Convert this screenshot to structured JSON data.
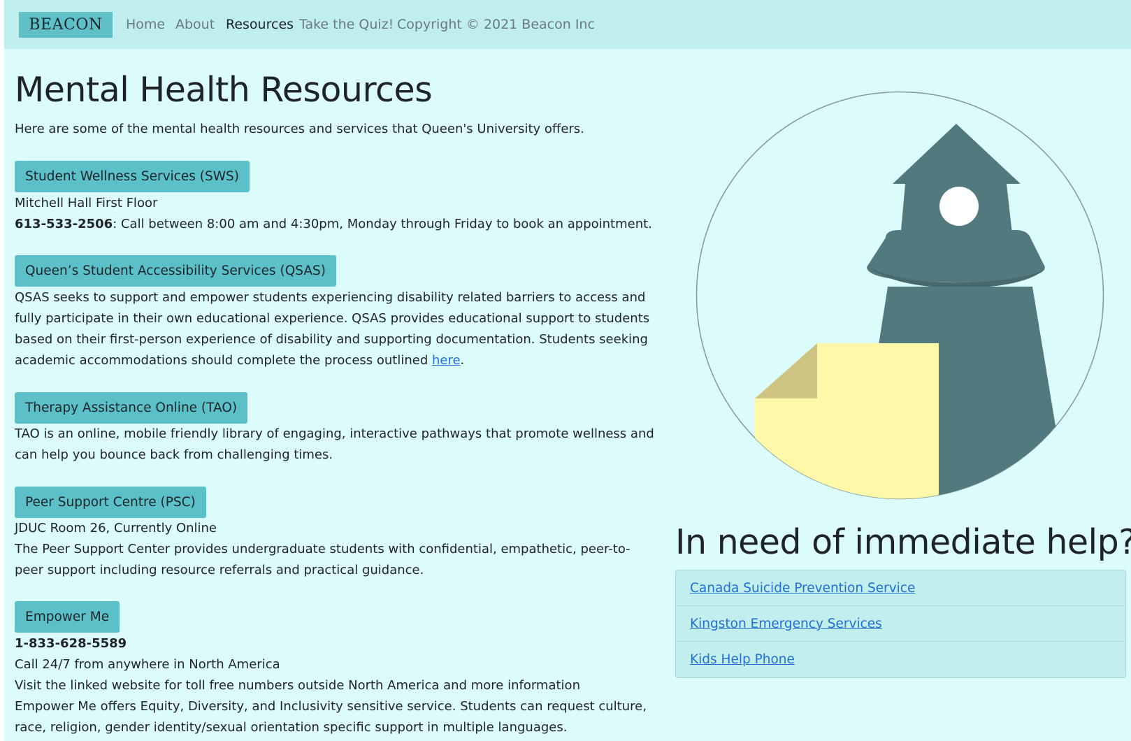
{
  "navbar": {
    "brand": "BEACON",
    "links": [
      "Home",
      "About",
      "Resources",
      "Take the Quiz!"
    ],
    "active": "Resources",
    "copyright": "Copyright © 2021 Beacon Inc"
  },
  "main": {
    "title": "Mental Health Resources",
    "intro": "Here are some of the mental health resources and services that Queen's University offers.",
    "sws": {
      "button": "Student Wellness Services (SWS)",
      "location": "Mitchell Hall First Floor",
      "phone": "613-533-2506",
      "hours": ": Call between 8:00 am and 4:30pm, Monday through Friday to book an appointment."
    },
    "qsas": {
      "button": "Queen’s Student Accessibility Services (QSAS)",
      "text": "QSAS seeks to support and empower students experiencing disability related barriers to access and fully participate in their own educational experience. QSAS provides educational support to students based on their first-person experience of disability and supporting documentation. Students seeking academic accommodations should complete the process outlined ",
      "link": "here",
      "after": "."
    },
    "tao": {
      "button": "Therapy Assistance Online (TAO)",
      "text": "TAO is an online, mobile friendly library of engaging, interactive pathways that promote wellness and can help you bounce back from challenging times."
    },
    "psc": {
      "button": "Peer Support Centre (PSC)",
      "location": "JDUC Room 26, Currently Online",
      "text": "The Peer Support Center provides undergraduate students with confidential, empathetic, peer-to-peer support including resource referrals and practical guidance."
    },
    "empower": {
      "button": "Empower Me",
      "phone": "1-833-628-5589",
      "line1": "Call 24/7 from anywhere in North America",
      "line2": "Visit the linked website for toll free numbers outside North America and more information",
      "text": "Empower Me offers Equity, Diversity, and Inclusivity sensitive service. Students can request culture, race, religion, gender identity/sexual orientation specific support in multiple languages."
    }
  },
  "sidebar": {
    "heading": "In need of immediate help?",
    "links": [
      "Canada Suicide Prevention Service",
      "Kingston Emergency Services",
      "Kids Help Phone"
    ]
  },
  "colors": {
    "background": "#dcfcfc",
    "navbar": "#c0eeee",
    "button": "#5cc0c9",
    "lighthouse": "#52797e",
    "note": "#fff8a8",
    "note_fold": "#cdc383",
    "link": "#1f6fd6"
  },
  "icons": {
    "logo": "lighthouse-sticky-note-logo"
  }
}
